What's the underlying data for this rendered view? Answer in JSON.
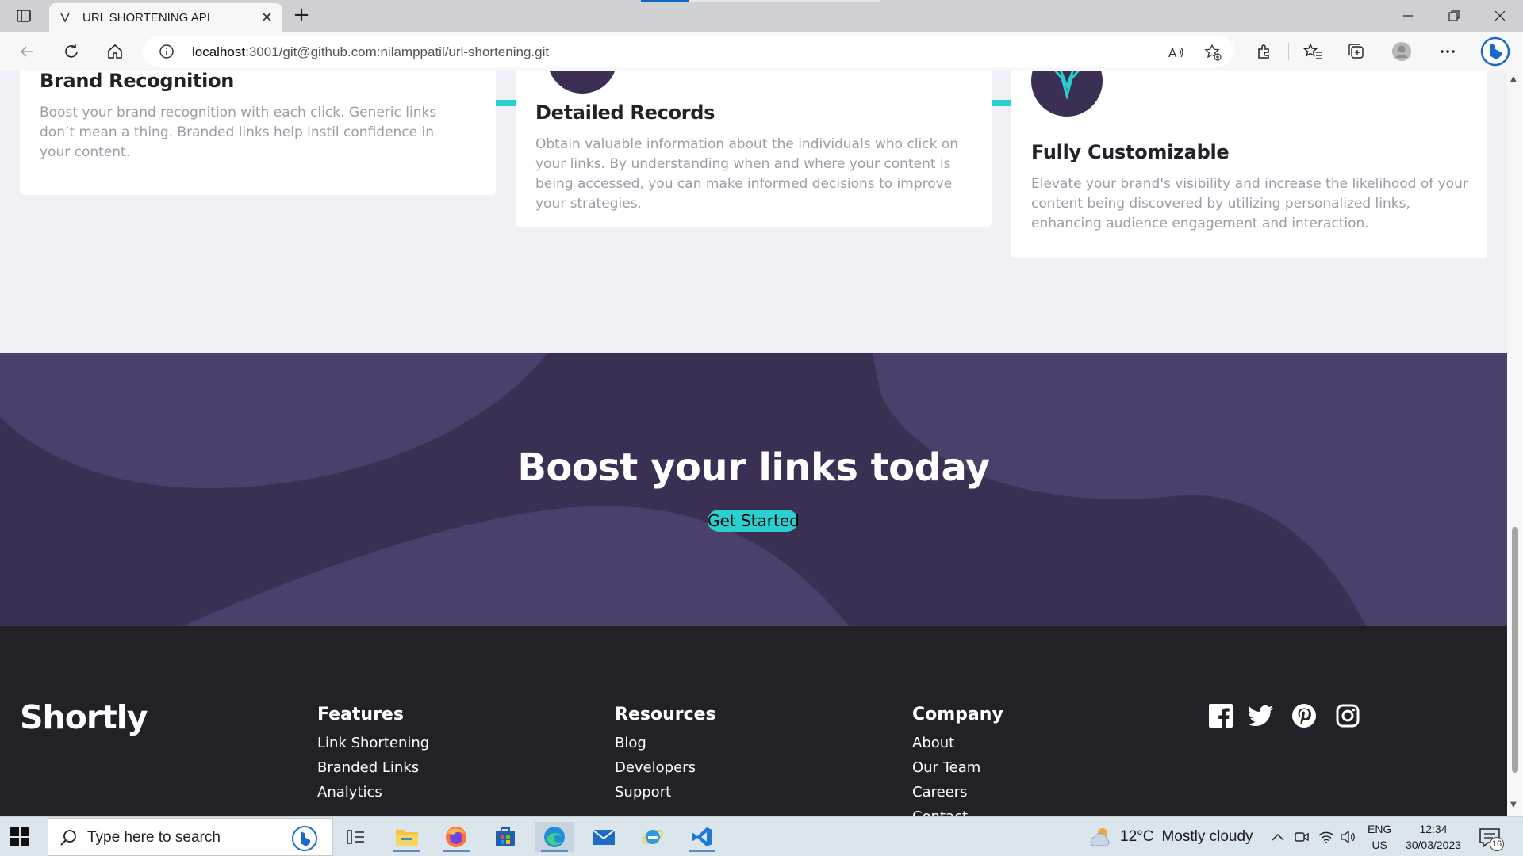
{
  "browser": {
    "tab_title": "URL SHORTENING API",
    "tab_close": "✕",
    "new_tab": "+",
    "url_host": "localhost",
    "url_rest": ":3001/git@github.com:nilamppatil/url-shortening.git",
    "accent": "#0a66c2"
  },
  "features": {
    "cards": [
      {
        "title": "Brand Recognition",
        "text": "Boost your brand recognition with each click. Generic links don’t mean a thing. Branded links help instil confidence in your content."
      },
      {
        "title": "Detailed Records",
        "text": "Obtain valuable information about the individuals who click on your links. By understanding when and where your content is being accessed, you can make informed decisions to improve your strategies."
      },
      {
        "title": "Fully Customizable",
        "text": "Elevate your brand's visibility and increase the likelihood of your content being discovered by utilizing personalized links, enhancing audience engagement and interaction."
      }
    ]
  },
  "boost": {
    "title": "Boost your links today",
    "button": "Get Started"
  },
  "footer": {
    "logo": "Shortly",
    "columns": [
      {
        "heading": "Features",
        "links": [
          "Link Shortening",
          "Branded Links",
          "Analytics"
        ]
      },
      {
        "heading": "Resources",
        "links": [
          "Blog",
          "Developers",
          "Support"
        ]
      },
      {
        "heading": "Company",
        "links": [
          "About",
          "Our Team",
          "Careers",
          "Contact"
        ]
      }
    ],
    "social_icons": [
      "facebook-icon",
      "twitter-icon",
      "pinterest-icon",
      "instagram-icon"
    ]
  },
  "colors": {
    "cyan": "#2acfcf",
    "dark_violet": "#3b3054",
    "very_dark": "#232127",
    "gray_text": "#9e9aa7"
  },
  "taskbar": {
    "search_placeholder": "Type here to search",
    "weather_temp": "12°C",
    "weather_desc": "Mostly cloudy",
    "lang_top": "ENG",
    "lang_bottom": "US",
    "time": "12:34",
    "date": "30/03/2023",
    "notif_count": "16"
  }
}
